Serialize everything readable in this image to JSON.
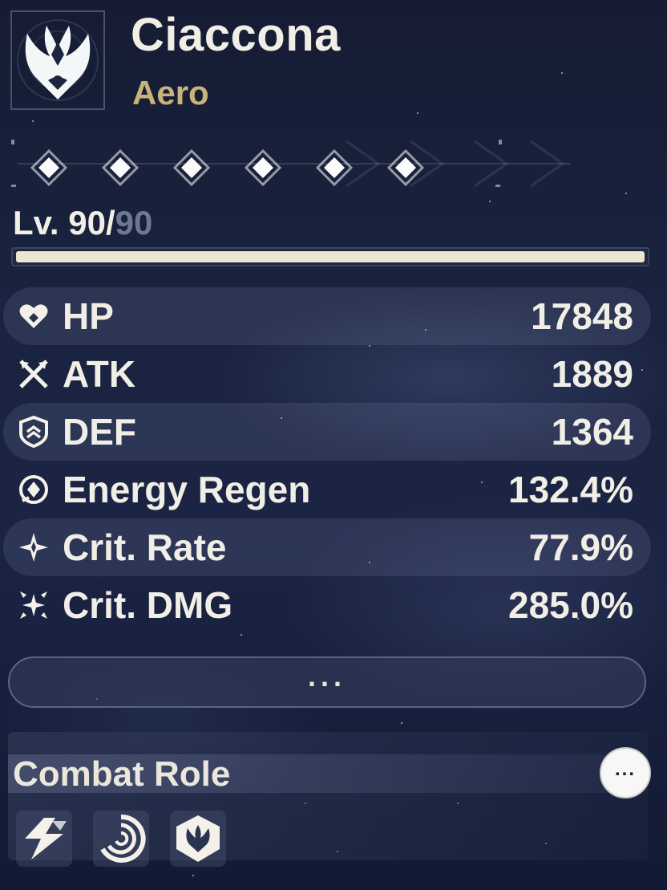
{
  "character": {
    "name": "Ciaccona",
    "element": "Aero",
    "emblem_icon": "aero-emblem-icon"
  },
  "sequence": {
    "nodes": 6,
    "icon": "diamond-node-icon"
  },
  "level": {
    "current": "90",
    "separator": "/",
    "max": "90",
    "prefix": "Lv. ",
    "progress": 1.0
  },
  "stats": [
    {
      "label": "HP",
      "value": "17848",
      "icon": "heart-icon"
    },
    {
      "label": "ATK",
      "value": "1889",
      "icon": "crossed-swords-icon"
    },
    {
      "label": "DEF",
      "value": "1364",
      "icon": "shield-icon"
    },
    {
      "label": "Energy Regen",
      "value": "132.4%",
      "icon": "energy-regen-icon"
    },
    {
      "label": "Crit. Rate",
      "value": "77.9%",
      "icon": "crit-rate-icon"
    },
    {
      "label": "Crit. DMG",
      "value": "285.0%",
      "icon": "crit-dmg-icon"
    }
  ],
  "more_button": {
    "label": "..."
  },
  "combat_role": {
    "title": "Combat Role",
    "more_label": "...",
    "roles": [
      {
        "icon": "lightning-bolt-icon"
      },
      {
        "icon": "swirl-icon"
      },
      {
        "icon": "aero-shield-icon"
      }
    ]
  },
  "colors": {
    "element": "#c9b37a",
    "text": "#f1eee6",
    "muted_level": "#6f7890",
    "xp_fill": "#ebe6d2"
  }
}
